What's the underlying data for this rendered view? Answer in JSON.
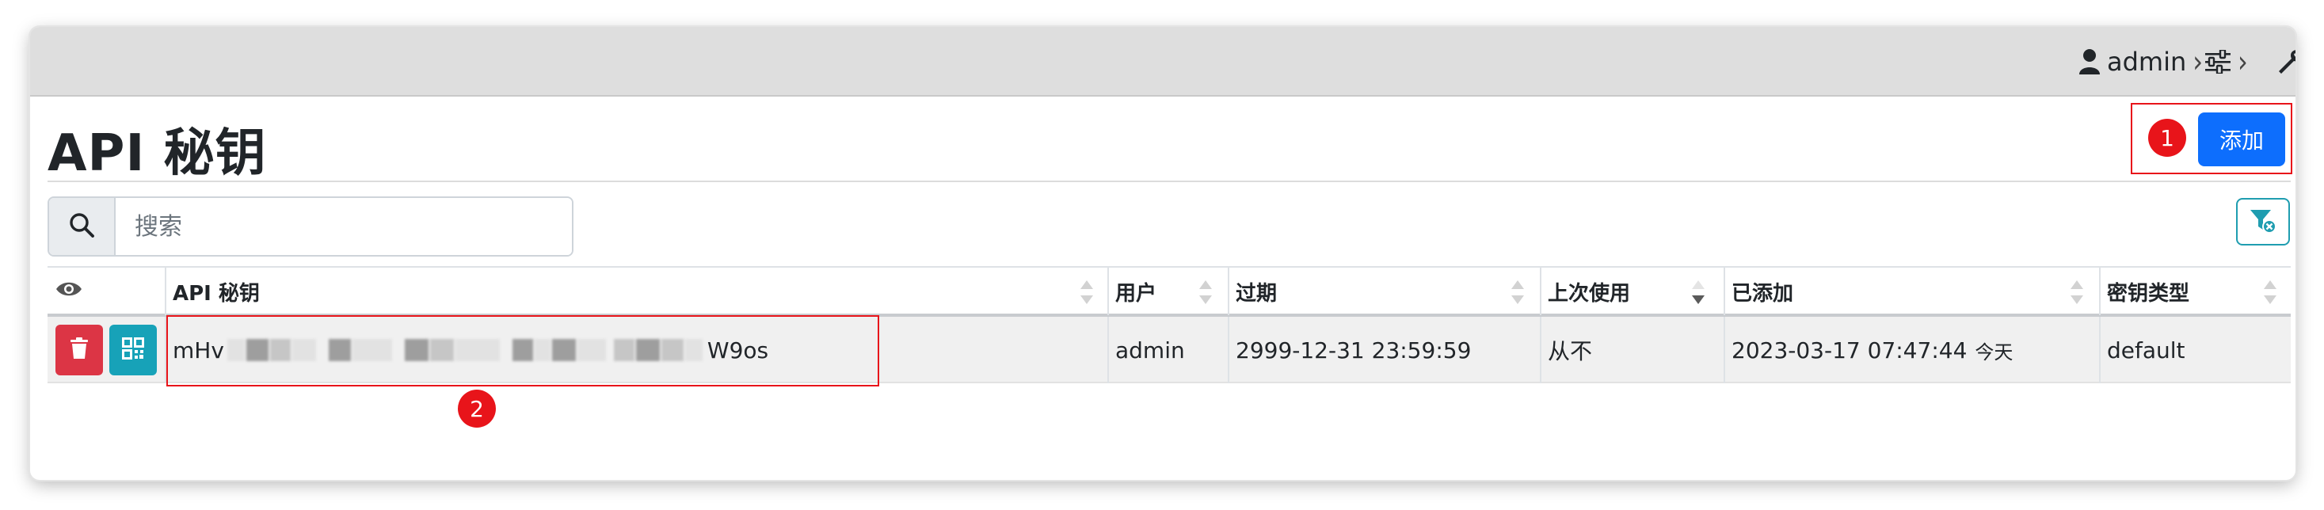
{
  "topbar": {
    "user_label": "admin",
    "user_icon": "person-icon",
    "settings_icon": "sliders-icon",
    "tools_icon": "wrench-icon",
    "chevron": "›"
  },
  "page": {
    "title": "API 秘钥",
    "add_label": "添加"
  },
  "annotations": {
    "step1": "1",
    "step2": "2",
    "highlight_color": "#e8141a"
  },
  "search": {
    "placeholder": "搜索",
    "value": ""
  },
  "table": {
    "columns": [
      "API 秘钥",
      "用户",
      "过期",
      "上次使用",
      "已添加",
      "密钥类型"
    ],
    "rows": [
      {
        "key_prefix": "mHv",
        "key_suffix": "W9os",
        "user": "admin",
        "expires": "2999-12-31 23:59:59",
        "last_used": "从不",
        "added": "2023-03-17 07:47:44",
        "added_relative": "今天",
        "key_type": "default"
      }
    ]
  },
  "colors": {
    "primary": "#0d6efd",
    "danger": "#dc3545",
    "info": "#17a2b8"
  }
}
